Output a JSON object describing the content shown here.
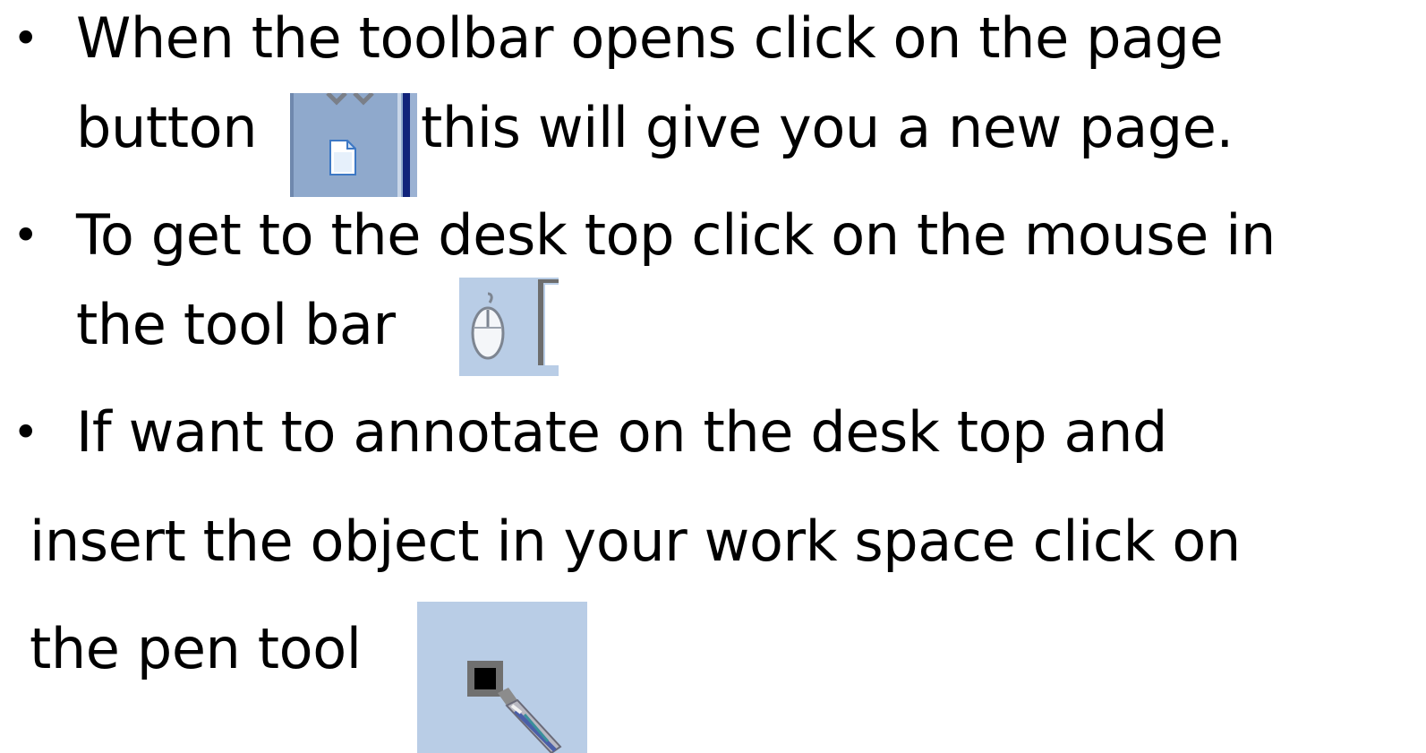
{
  "bullets": [
    {
      "symbol": "•",
      "line1": "When the toolbar opens click on the page",
      "line2_before": "button",
      "line2_after": "this will give you a new page."
    },
    {
      "symbol": "•",
      "line1": "To get to the desk top click on the mouse in",
      "line2_before": "the tool bar"
    },
    {
      "symbol": "•",
      "line1": "If want to annotate on the desk top and",
      "line2": "insert the object in your work space click on",
      "line3_before": "the pen tool"
    }
  ],
  "icons": {
    "page": "page-icon",
    "mouse": "mouse-icon",
    "pen": "pen-icon"
  },
  "colors": {
    "icon_background": "#b9cde6",
    "page_button_background": "#8fa9cc",
    "toolbar_separator": "#11237a"
  }
}
